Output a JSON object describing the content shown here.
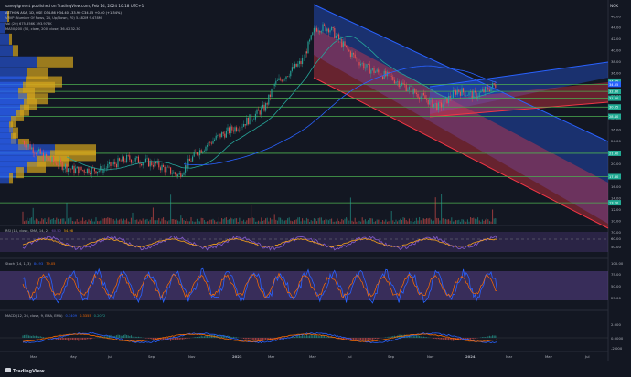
{
  "header": {
    "publisher": "savepigment published on TradingView.com, Feb 14, 2024 10:18 UTC+1",
    "symbol_line": "AETHON ASA, 1D, OSE  O34.86 H34.40 L33.90 C34.05 +0.40 (+1.54%)",
    "vrvp_line": "VRVP (Number Of Rows, 24, Up/Down, 70)  5.482M  9.478M",
    "vol_line": "Vol (20)  675.356K  393.978K",
    "ma_line": "MA50/200 (50, close, 200, close)  36.42  32.30",
    "symbol_tag": "NOK"
  },
  "price_axis": {
    "ticks": [
      "46.00",
      "44.00",
      "42.00",
      "40.00",
      "38.00",
      "36.00",
      "34.00",
      "32.00",
      "30.00",
      "28.00",
      "26.00",
      "24.00",
      "22.00",
      "20.00",
      "18.00",
      "16.00",
      "14.00",
      "12.00",
      "10.00"
    ],
    "tags": [
      {
        "label": "34.05",
        "color": "#26a69a"
      },
      {
        "label": "34.05",
        "color": "#2962ff"
      },
      {
        "label": "32.80",
        "color": "#22ab94"
      },
      {
        "label": "31.60",
        "color": "#22ab94"
      },
      {
        "label": "30.05",
        "color": "#22ab94"
      },
      {
        "label": "28.40",
        "color": "#22ab94"
      },
      {
        "label": "21.90",
        "color": "#22ab94"
      },
      {
        "label": "17.80",
        "color": "#22ab94"
      },
      {
        "label": "13.20",
        "color": "#22ab94"
      }
    ]
  },
  "time_axis": [
    "Mar",
    "May",
    "Jul",
    "Sep",
    "Nov",
    "2023",
    "Mar",
    "May",
    "Jul",
    "Sep",
    "Nov",
    "2024",
    "Mar",
    "May",
    "Jul"
  ],
  "rsi": {
    "label": "RSI (14, close, SMA, 14, 2)",
    "v1": "60.50",
    "v2": "54.98",
    "ticks": [
      "70.00",
      "60.00",
      "50.00"
    ]
  },
  "stoch": {
    "label": "Stoch (14, 1, 3)",
    "v1": "84.93",
    "v2": "79.05",
    "ticks": [
      "100.00",
      "75.00",
      "50.00",
      "25.00"
    ]
  },
  "macd": {
    "label": "MACD (12, 26, close, 9, EMA, EMA)",
    "v1": "0.1409",
    "v2": "0.3355",
    "v3": "0.2072",
    "ticks": [
      "2.000",
      "0.0000",
      "-2.000"
    ]
  },
  "footer": {
    "brand": "TradingView"
  },
  "colors": {
    "bg": "#131722",
    "green": "#4caf50",
    "blue": "#2962ff",
    "red": "#f23645",
    "rsi_line": "#7e57c2",
    "ma50": "#26a69a",
    "ma200": "#2962ff",
    "vp_blue": "#2962ff",
    "vp_yellow": "#d6a61c"
  }
}
